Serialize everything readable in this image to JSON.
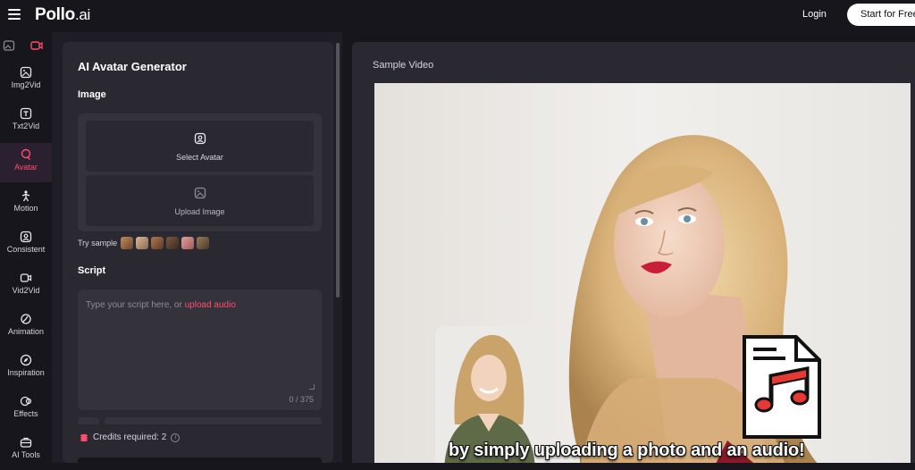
{
  "header": {
    "logo_main": "Pollo",
    "logo_suffix": ".ai",
    "login_label": "Login",
    "start_label": "Start for Free"
  },
  "sidebar": {
    "items": [
      {
        "label": "Img2Vid",
        "icon": "image-video-icon"
      },
      {
        "label": "Txt2Vid",
        "icon": "text-video-icon"
      },
      {
        "label": "Avatar",
        "icon": "avatar-icon",
        "active": true
      },
      {
        "label": "Motion",
        "icon": "motion-icon"
      },
      {
        "label": "Consistent",
        "icon": "consistent-icon"
      },
      {
        "label": "Vid2Vid",
        "icon": "video-video-icon"
      },
      {
        "label": "Animation",
        "icon": "animation-icon"
      },
      {
        "label": "Inspiration",
        "icon": "compass-icon"
      },
      {
        "label": "Effects",
        "icon": "effects-icon"
      },
      {
        "label": "AI Tools",
        "icon": "toolbox-icon"
      }
    ]
  },
  "panel": {
    "title": "AI Avatar Generator",
    "image_label": "Image",
    "select_avatar": "Select Avatar",
    "upload_image": "Upload Image",
    "try_sample": "Try sample",
    "script_label": "Script",
    "script_placeholder": "Type your script here, or ",
    "upload_audio": "upload audio",
    "char_count": "0 / 375",
    "credits": "Credits required: 2",
    "info": "i"
  },
  "sample": {
    "title": "Sample Video",
    "caption": "by simply uploading a photo and an audio!"
  },
  "colors": {
    "accent": "#ff4d6d",
    "background": "#17161c",
    "panel": "#2a2932"
  }
}
